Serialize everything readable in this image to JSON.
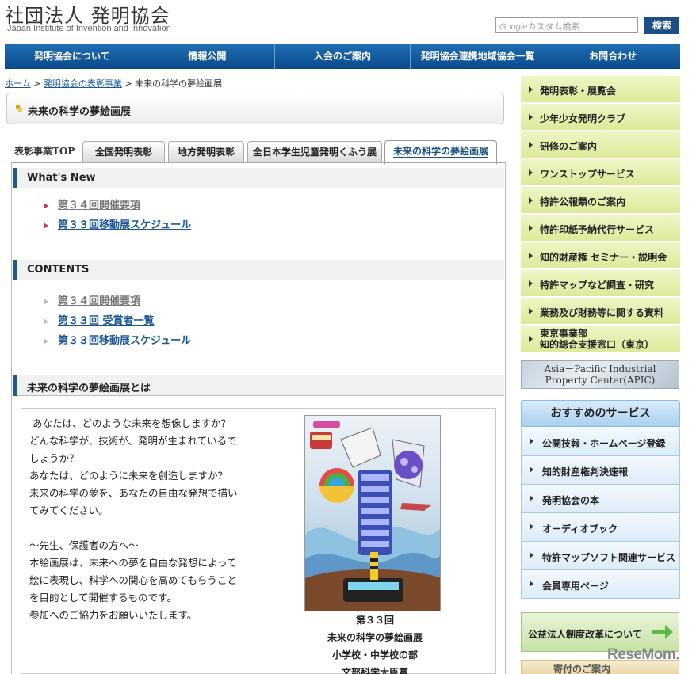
{
  "header": {
    "title_jp": "社団法人 発明協会",
    "title_en": "Japan Institute of Invention and Innovation",
    "search_placeholder_brand": "Google",
    "search_placeholder": "カスタム検索",
    "search_button": "検索"
  },
  "gnav": [
    "発明協会について",
    "情報公開",
    "入会のご案内",
    "発明協会連携地域協会一覧",
    "お問合わせ"
  ],
  "breadcrumb": {
    "home": "ホーム",
    "sep": ">",
    "parent": "発明協会の表彰事業",
    "current": "未来の科学の夢絵画展"
  },
  "page_title": "未来の科学の夢絵画展",
  "tabs": {
    "label": "表彰事業TOP",
    "items": [
      "全国発明表彰",
      "地方発明表彰",
      "全日本学生児童発明くふう展",
      "未来の科学の夢絵画展"
    ]
  },
  "whats_new": {
    "heading": "What's New",
    "links": [
      "第３４回開催要項",
      "第３３回移動展スケジュール"
    ]
  },
  "contents": {
    "heading": "CONTENTS",
    "links": [
      "第３４回開催要項",
      "第３３回 受賞者一覧",
      "第３３回移動展スケジュール"
    ]
  },
  "about": {
    "heading": "未来の科学の夢絵画展とは",
    "body1": " あなたは、どのような未来を想像しますか？\nどんな科学が、技術が、発明が生まれているでしょうか？\nあなたは、どのように未来を創造しますか？\n未来の科学の夢を、あなたの自由な発想で描いてみてください。",
    "body2": "〜先生、保護者の方へ〜\n本絵画展は、未来への夢を自由な発想によって絵に表現し、科学への関心を高めてもらうことを目的として開催するものです。\n参加へのご協力をお願いいたします。",
    "caption": [
      "第３３回",
      "未来の科学の夢絵画展",
      "小学校・中学校の部",
      "文部科学大臣賞"
    ]
  },
  "sidebar": {
    "items": [
      "発明表彰・展覧会",
      "少年少女発明クラブ",
      "研修のご案内",
      "ワンストップサービス",
      "特許公報類のご案内",
      "特許印紙予納代行サービス",
      "知的財産権 セミナー・説明会",
      "特許マップなど調査・研究",
      "業務及び財務等に関する資料"
    ],
    "item_tokyo_1": "東京事業部",
    "item_tokyo_2": "知的総合支援窓口（東京）",
    "apic_1": "Asia－Pacific Industrial",
    "apic_2": "Property Center(APIC)"
  },
  "services": {
    "heading": "おすすめのサービス",
    "items": [
      "公開技報・ホームページ登録",
      "知的財産権判決速報",
      "発明協会の本",
      "オーディオブック",
      "特許マップソフト関連サービス",
      "会員専用ページ"
    ]
  },
  "banner": {
    "label": "公益法人制度改革について",
    "bottom_label": "寄付のご案内"
  },
  "watermark": "ReseMom."
}
